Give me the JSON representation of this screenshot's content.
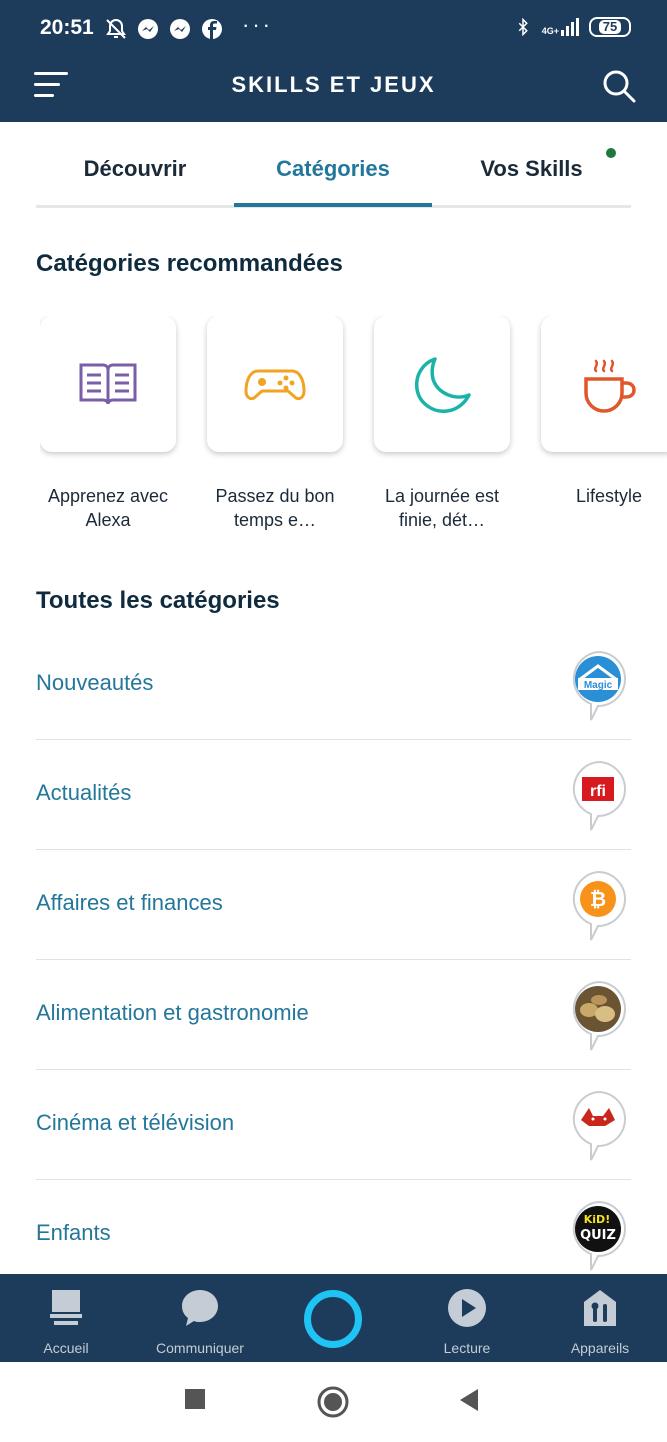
{
  "status_bar": {
    "time": "20:51",
    "network": "4G+",
    "battery": "75",
    "icons": [
      "alarm-off-icon",
      "messenger-icon",
      "messenger-icon",
      "facebook-icon",
      "more-dots-icon",
      "bluetooth-icon",
      "signal-icon"
    ]
  },
  "app_bar": {
    "title": "SKILLS ET JEUX"
  },
  "tabs": [
    {
      "label": "Découvrir",
      "active": false
    },
    {
      "label": "Catégories",
      "active": true
    },
    {
      "label": "Vos Skills",
      "active": false,
      "notification_dot": true
    }
  ],
  "recommended": {
    "title": "Catégories recommandées",
    "items": [
      {
        "label": "Apprenez avec Alexa",
        "icon": "book-icon",
        "color": "#7a5ea8"
      },
      {
        "label": "Passez du bon temps e…",
        "icon": "gamepad-icon",
        "color": "#f2a324"
      },
      {
        "label": "La journée est finie, dét…",
        "icon": "moon-icon",
        "color": "#1bb3a8"
      },
      {
        "label": "Lifestyle",
        "icon": "coffee-cup-icon",
        "color": "#e0572a"
      }
    ]
  },
  "all_categories": {
    "title": "Toutes les catégories",
    "items": [
      {
        "label": "Nouveautés",
        "thumb": "magic-home-icon"
      },
      {
        "label": "Actualités",
        "thumb": "rfi-icon"
      },
      {
        "label": "Affaires et finances",
        "thumb": "bitcoin-icon"
      },
      {
        "label": "Alimentation et gastronomie",
        "thumb": "cheese-icon"
      },
      {
        "label": "Cinéma et télévision",
        "thumb": "fox-icon"
      },
      {
        "label": "Enfants",
        "thumb": "kid-quiz-icon"
      }
    ]
  },
  "bottom_nav": [
    {
      "label": "Accueil",
      "icon": "home-icon"
    },
    {
      "label": "Communiquer",
      "icon": "chat-icon"
    },
    {
      "label": "",
      "icon": "alexa-ring-icon"
    },
    {
      "label": "Lecture",
      "icon": "play-icon"
    },
    {
      "label": "Appareils",
      "icon": "devices-icon"
    }
  ],
  "colors": {
    "header": "#1d3b5a",
    "accent": "#23779a",
    "alexa": "#1fc3f4"
  }
}
